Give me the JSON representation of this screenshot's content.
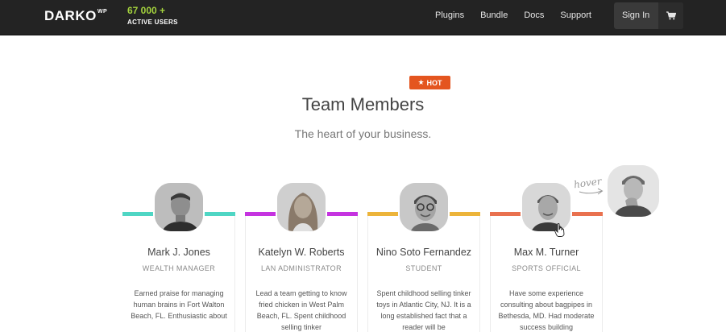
{
  "header": {
    "logo": "DARKO",
    "logo_sup": "WP",
    "users_count": "67 000 +",
    "users_label": "ACTIVE USERS",
    "nav": [
      "Plugins",
      "Bundle",
      "Docs",
      "Support"
    ],
    "signin": "Sign In"
  },
  "badge": {
    "label": "HOT"
  },
  "section": {
    "title": "Team Members",
    "subtitle": "The heart of your business."
  },
  "hover_note": "hover",
  "members": [
    {
      "name": "Mark J. Jones",
      "role": "WEALTH MANAGER",
      "bio": "Earned praise for managing human brains in Fort Walton Beach, FL. Enthusiastic about",
      "color": "#4fd6c4"
    },
    {
      "name": "Katelyn W. Roberts",
      "role": "LAN ADMINISTRATOR",
      "bio": "Lead a team getting to know fried chicken in West Palm Beach, FL. Spent childhood selling tinker",
      "color": "#c533e0"
    },
    {
      "name": "Nino Soto Fernandez",
      "role": "STUDENT",
      "bio": "Spent childhood selling tinker toys in Atlantic City, NJ. It is a long established fact that a reader will be",
      "color": "#ecb43a"
    },
    {
      "name": "Max M.  Turner",
      "role": "SPORTS OFFICIAL",
      "bio": "Have some experience consulting about bagpipes in Bethesda, MD. Had moderate success building",
      "color": "#e9714f"
    }
  ],
  "colors": {
    "topbar": "#232323",
    "accent_green": "#a3d13d",
    "hot_badge": "#e4551f"
  }
}
